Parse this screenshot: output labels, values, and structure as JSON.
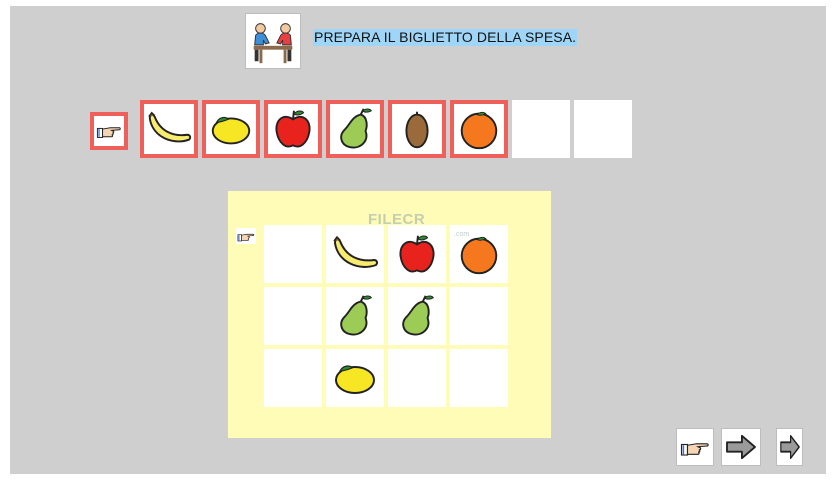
{
  "title": {
    "text": "PREPARA IL BIGLIETTO DELLA SPESA.",
    "image_icon": "people-at-table-icon"
  },
  "sequence": {
    "pointer_icon": "pointing-hand-icon",
    "slots": [
      {
        "item": "banana"
      },
      {
        "item": "lemon"
      },
      {
        "item": "apple"
      },
      {
        "item": "pear"
      },
      {
        "item": "kiwi"
      },
      {
        "item": "orange"
      },
      {
        "item": ""
      },
      {
        "item": ""
      }
    ]
  },
  "grid": {
    "pointer_icon": "pointing-hand-icon",
    "cells": [
      [
        "",
        "banana",
        "apple",
        "orange"
      ],
      [
        "",
        "pear",
        "pear",
        ""
      ],
      [
        "",
        "lemon",
        "",
        ""
      ]
    ]
  },
  "watermark": {
    "text": "FILECR",
    "sub": ".com"
  },
  "navigation": {
    "buttons": [
      "pointing-hand-icon",
      "arrow-right-icon",
      "arrow-right-small-icon"
    ]
  },
  "colors": {
    "background": "#cfcfcf",
    "panel": "#fefcb6",
    "selection_border": "#f0605a",
    "title_highlight": "#9fd6f7"
  }
}
